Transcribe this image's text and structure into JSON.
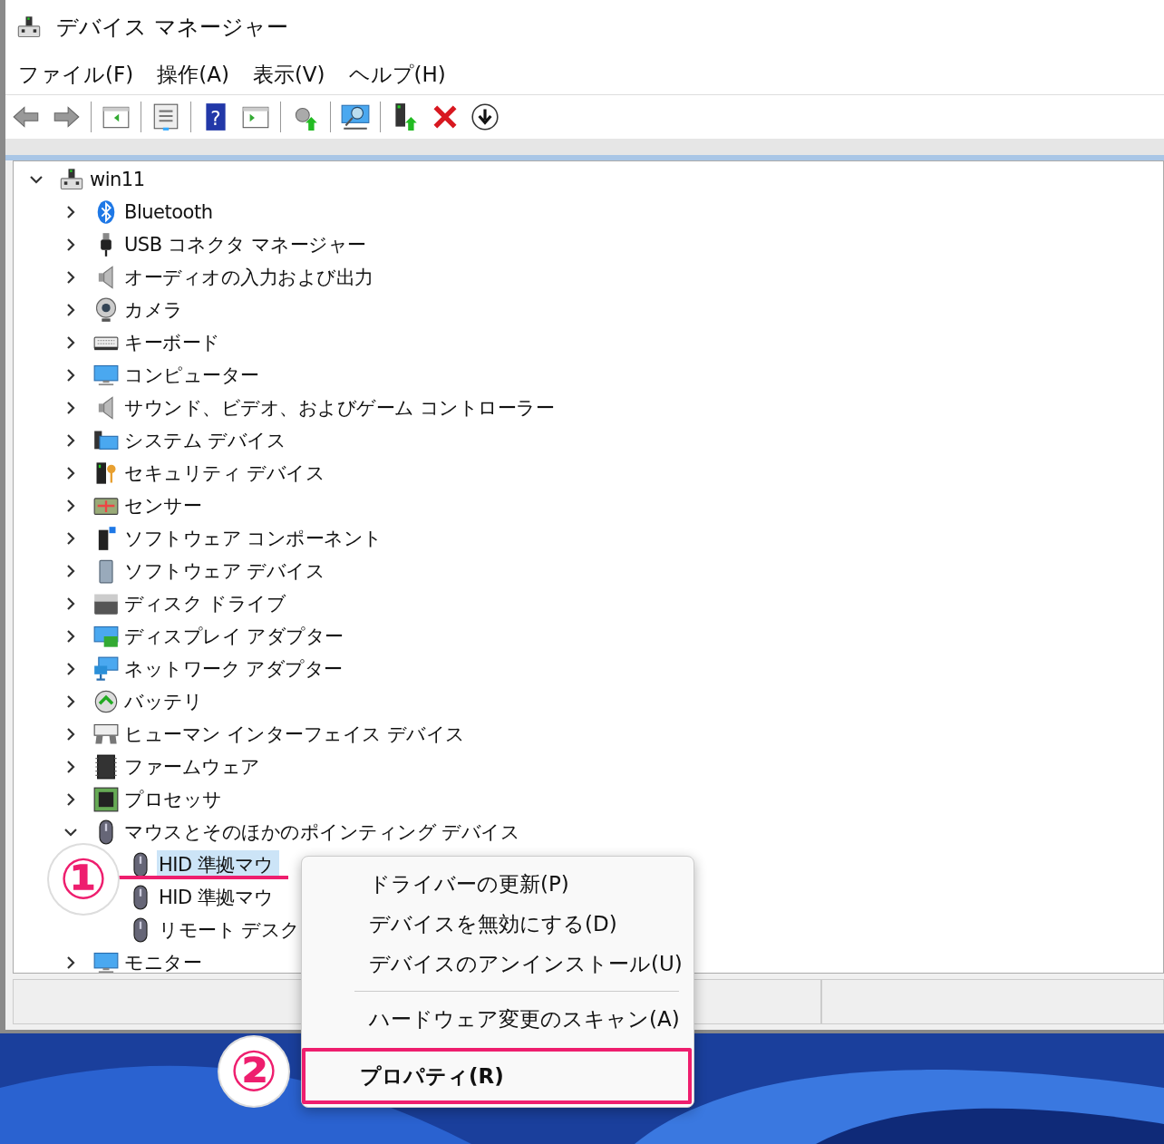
{
  "window": {
    "title": "デバイス マネージャー"
  },
  "menu_bar": [
    {
      "label": "ファイル(F)"
    },
    {
      "label": "操作(A)"
    },
    {
      "label": "表示(V)"
    },
    {
      "label": "ヘルプ(H)"
    }
  ],
  "toolbar": {
    "help_glyph": "?"
  },
  "tree": {
    "label": "win11",
    "kind": "computer",
    "expanded": true,
    "selected": false,
    "children": [
      {
        "label": "Bluetooth",
        "kind": "bluetooth",
        "expanded": false,
        "selected": false
      },
      {
        "label": "USB コネクタ マネージャー",
        "kind": "usb",
        "expanded": false,
        "selected": false
      },
      {
        "label": "オーディオの入力および出力",
        "kind": "speaker",
        "expanded": false,
        "selected": false
      },
      {
        "label": "カメラ",
        "kind": "camera",
        "expanded": false,
        "selected": false
      },
      {
        "label": "キーボード",
        "kind": "keyboard",
        "expanded": false,
        "selected": false
      },
      {
        "label": "コンピューター",
        "kind": "monitor",
        "expanded": false,
        "selected": false
      },
      {
        "label": "サウンド、ビデオ、およびゲーム コントローラー",
        "kind": "speaker",
        "expanded": false,
        "selected": false
      },
      {
        "label": "システム デバイス",
        "kind": "system",
        "expanded": false,
        "selected": false
      },
      {
        "label": "セキュリティ デバイス",
        "kind": "security",
        "expanded": false,
        "selected": false
      },
      {
        "label": "センサー",
        "kind": "sensor",
        "expanded": false,
        "selected": false
      },
      {
        "label": "ソフトウェア コンポーネント",
        "kind": "software",
        "expanded": false,
        "selected": false
      },
      {
        "label": "ソフトウェア デバイス",
        "kind": "softdevice",
        "expanded": false,
        "selected": false
      },
      {
        "label": "ディスク ドライブ",
        "kind": "disk",
        "expanded": false,
        "selected": false
      },
      {
        "label": "ディスプレイ アダプター",
        "kind": "display",
        "expanded": false,
        "selected": false
      },
      {
        "label": "ネットワーク アダプター",
        "kind": "network",
        "expanded": false,
        "selected": false
      },
      {
        "label": "バッテリ",
        "kind": "battery",
        "expanded": false,
        "selected": false
      },
      {
        "label": "ヒューマン インターフェイス デバイス",
        "kind": "hid",
        "expanded": false,
        "selected": false
      },
      {
        "label": "ファームウェア",
        "kind": "chip",
        "expanded": false,
        "selected": false
      },
      {
        "label": "プロセッサ",
        "kind": "processor",
        "expanded": false,
        "selected": false
      },
      {
        "label": "マウスとそのほかのポインティング デバイス",
        "kind": "mouse",
        "expanded": true,
        "selected": false,
        "children": [
          {
            "label": "HID 準拠マウ",
            "kind": "mouse",
            "selected": true
          },
          {
            "label": "HID 準拠マウ",
            "kind": "mouse",
            "selected": false
          },
          {
            "label": "リモート デスク",
            "kind": "mouse",
            "selected": false
          }
        ]
      },
      {
        "label": "モニター",
        "kind": "monitor",
        "expanded": false,
        "selected": false
      }
    ]
  },
  "context_menu": {
    "items": [
      {
        "label": "ドライバーの更新(P)",
        "separator_before": false,
        "bold": false,
        "outlined": false
      },
      {
        "label": "デバイスを無効にする(D)",
        "separator_before": false,
        "bold": false,
        "outlined": false
      },
      {
        "label": "デバイスのアンインストール(U)",
        "separator_before": false,
        "bold": false,
        "outlined": false
      },
      {
        "label": "ハードウェア変更のスキャン(A)",
        "separator_before": true,
        "bold": false,
        "outlined": false
      },
      {
        "label": "プロパティ(R)",
        "separator_before": false,
        "bold": true,
        "outlined": true
      }
    ]
  },
  "annotations": [
    {
      "label": "①"
    },
    {
      "label": "②"
    }
  ]
}
